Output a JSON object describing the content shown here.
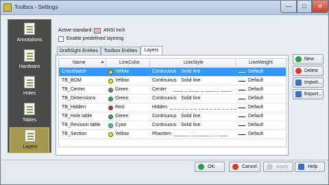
{
  "window": {
    "title": "Toolbox - Settings",
    "minimize": "—",
    "maximize": "□",
    "close": "✕"
  },
  "sidebar": {
    "items": [
      {
        "label": "Annotations",
        "icon": "annotations-icon"
      },
      {
        "label": "Hardware",
        "icon": "hardware-icon"
      },
      {
        "label": "Holes",
        "icon": "holes-icon"
      },
      {
        "label": "Tables",
        "icon": "tables-icon"
      },
      {
        "label": "Layers",
        "icon": "layers-icon",
        "active": true
      }
    ]
  },
  "standard": {
    "label": "Active standard:",
    "value": "ANSI Inch"
  },
  "layering": {
    "label": "Enable predefined layering",
    "checked": false
  },
  "tabs": [
    {
      "label": "DraftSight Entities"
    },
    {
      "label": "Toolbox Entities"
    },
    {
      "label": "Layers",
      "selected": true
    }
  ],
  "grid": {
    "columns": [
      "Name",
      "LineColor",
      "LineStyle",
      "LineWeight"
    ],
    "rows": [
      {
        "name": "Crosshatch",
        "color": "Yellow",
        "colorHex": "#f2e600",
        "style": "Continuous",
        "style_desc": "Solid line",
        "weight": "Default",
        "selected": true
      },
      {
        "name": "TB_BOM",
        "color": "Yellow",
        "colorHex": "#f2e600",
        "style": "Continuous",
        "style_desc": "Solid line",
        "weight": "Default"
      },
      {
        "name": "TB_Center",
        "color": "Green",
        "colorHex": "#22b14c",
        "style": "Center",
        "style_desc": "____ _ ____ _ ____ _ ____",
        "weight": "Default"
      },
      {
        "name": "TB_Dimensions",
        "color": "Green",
        "colorHex": "#22b14c",
        "style": "Continuous",
        "style_desc": "Solid line",
        "weight": "Default"
      },
      {
        "name": "TB_Hidden",
        "color": "Red",
        "colorHex": "#d42020",
        "style": "Hidden",
        "style_desc": "_ _ _ _ _ _ _ _ _ _ _ _ _ _ _ _ _",
        "weight": "Default"
      },
      {
        "name": "TB_Hole table",
        "color": "Green",
        "colorHex": "#22b14c",
        "style": "Continuous",
        "style_desc": "Solid line",
        "weight": "Default"
      },
      {
        "name": "TB_Revision table",
        "color": "Cyan",
        "colorHex": "#20d0e0",
        "style": "Continuous",
        "style_desc": "Solid line",
        "weight": "Default"
      },
      {
        "name": "TB_Section",
        "color": "Yellow",
        "colorHex": "#f2e600",
        "style": "Phantom",
        "style_desc": "_____ _ _ _____ _ _ ___",
        "weight": "Default"
      }
    ]
  },
  "actions": {
    "new": "New",
    "delete": "Delete",
    "import": "Import...",
    "export": "Export..."
  },
  "footer": {
    "ok": "OK",
    "cancel": "Cancel",
    "apply": "Apply",
    "help": "Help"
  }
}
